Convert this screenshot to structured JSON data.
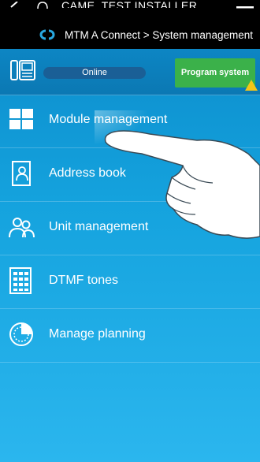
{
  "header": {
    "username": "CAME_TEST INSTALLER",
    "breadcrumb": "MTM A Connect > System management"
  },
  "status": {
    "badge": "Online",
    "program_button": "Program system"
  },
  "menu": {
    "items": [
      {
        "label": "Module management",
        "icon": "module-grid-icon"
      },
      {
        "label": "Address book",
        "icon": "address-book-icon"
      },
      {
        "label": "Unit management",
        "icon": "users-icon"
      },
      {
        "label": "DTMF tones",
        "icon": "keypad-icon"
      },
      {
        "label": "Manage planning",
        "icon": "clock-icon"
      }
    ]
  },
  "colors": {
    "background": "#15a3de",
    "header": "#000000",
    "program_button": "#3bb14a",
    "warning": "#f5c518",
    "badge": "#1a5f96"
  }
}
